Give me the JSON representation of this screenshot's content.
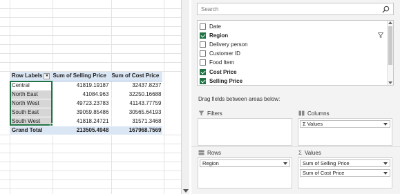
{
  "pivot": {
    "header": {
      "row_labels": "Row Labels",
      "col1": "Sum of Selling Price",
      "col2": "Sum of  Cost Price"
    },
    "rows": [
      {
        "label": "Central",
        "selling": "41819.19187",
        "cost": "32437.8237"
      },
      {
        "label": "North East",
        "selling": "41084.963",
        "cost": "32250.16688"
      },
      {
        "label": "North West",
        "selling": "49723.23783",
        "cost": "41143.77759"
      },
      {
        "label": "South East",
        "selling": "39059.85486",
        "cost": "30565.64193"
      },
      {
        "label": "South West",
        "selling": "41818.24721",
        "cost": "31571.3468"
      }
    ],
    "total": {
      "label": "Grand Total",
      "selling": "213505.4948",
      "cost": "167968.7569"
    }
  },
  "field_pane": {
    "search_placeholder": "Search",
    "fields": [
      {
        "label": "Date",
        "checked": false,
        "bold": false
      },
      {
        "label": "Region",
        "checked": true,
        "bold": true
      },
      {
        "label": "Delivery person",
        "checked": false,
        "bold": false
      },
      {
        "label": "Customer ID",
        "checked": false,
        "bold": false
      },
      {
        "label": "Food Item",
        "checked": false,
        "bold": false
      },
      {
        "label": "Cost Price",
        "checked": true,
        "bold": true
      },
      {
        "label": "Selling Price",
        "checked": true,
        "bold": true
      }
    ],
    "drag_title": "Drag fields between areas below:",
    "areas": {
      "filters": {
        "title": "Filters",
        "items": []
      },
      "columns": {
        "title": "Columns",
        "items": [
          "Σ Values"
        ]
      },
      "rows": {
        "title": "Rows",
        "items": [
          "Region"
        ]
      },
      "values": {
        "title": "Values",
        "items": [
          "Sum of Selling Price",
          "Sum of  Cost Price"
        ]
      }
    }
  },
  "colors": {
    "accent": "#217346",
    "pivot_header": "#dbe6f4",
    "pane_bg": "#f3f3f3"
  }
}
